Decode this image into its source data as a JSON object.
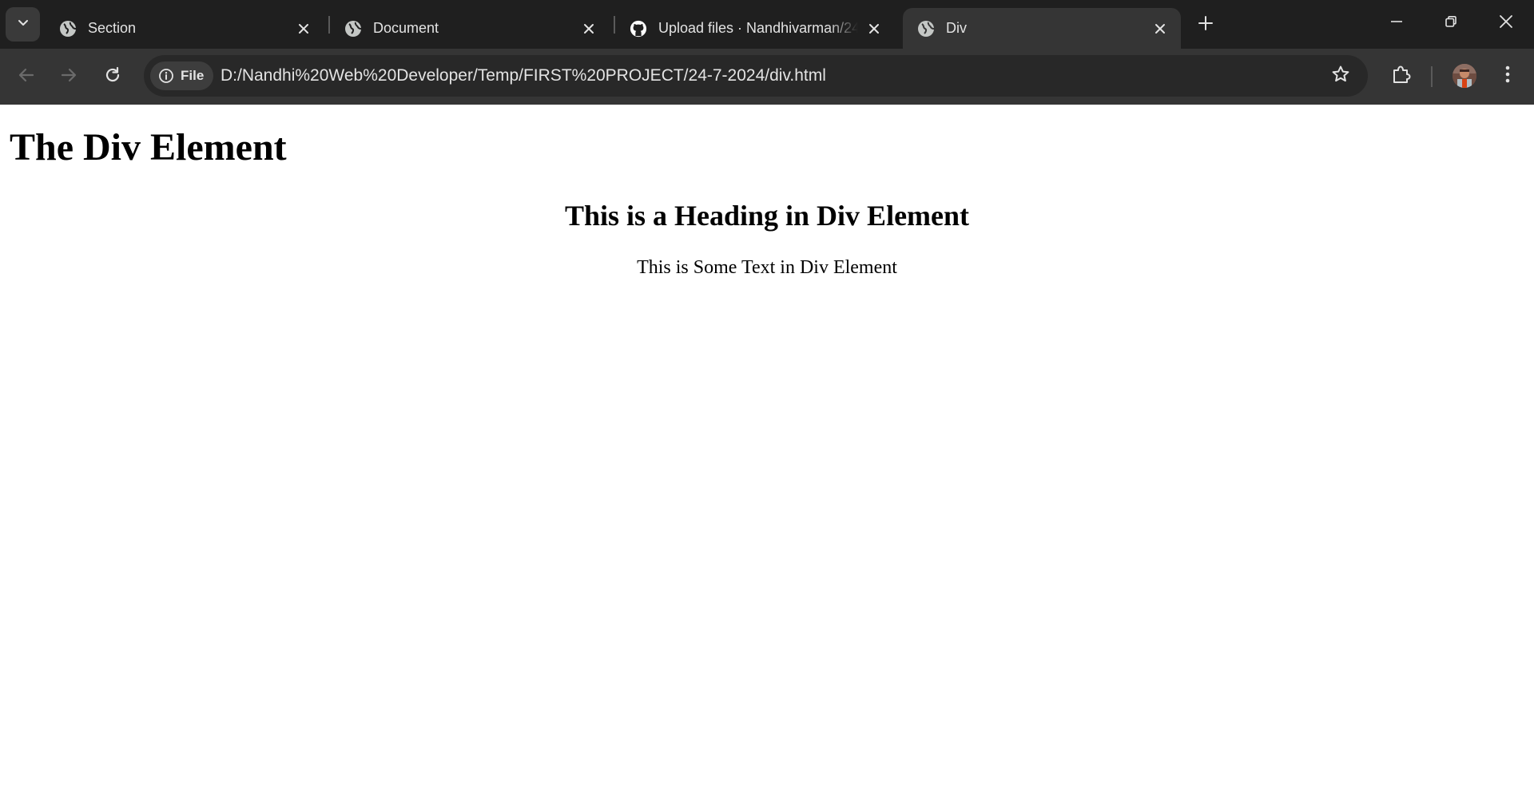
{
  "browser": {
    "tabs": [
      {
        "title": "Section",
        "icon": "globe-icon",
        "active": false
      },
      {
        "title": "Document",
        "icon": "globe-icon",
        "active": false
      },
      {
        "title": "Upload files · Nandhivarman/24",
        "icon": "github-icon",
        "active": false
      },
      {
        "title": "Div",
        "icon": "globe-icon",
        "active": true
      }
    ],
    "address": {
      "scheme_chip": "File",
      "url": "D:/Nandhi%20Web%20Developer/Temp/FIRST%20PROJECT/24-7-2024/div.html"
    },
    "colors": {
      "tabstrip": "#1f1f1f",
      "toolbar": "#353535",
      "omnibox": "#282828",
      "text": "#e3e3e3"
    }
  },
  "page": {
    "title_heading": "The Div Element",
    "div": {
      "heading": "This is a Heading in Div Element",
      "text": "This is Some Text in Div Element"
    }
  }
}
